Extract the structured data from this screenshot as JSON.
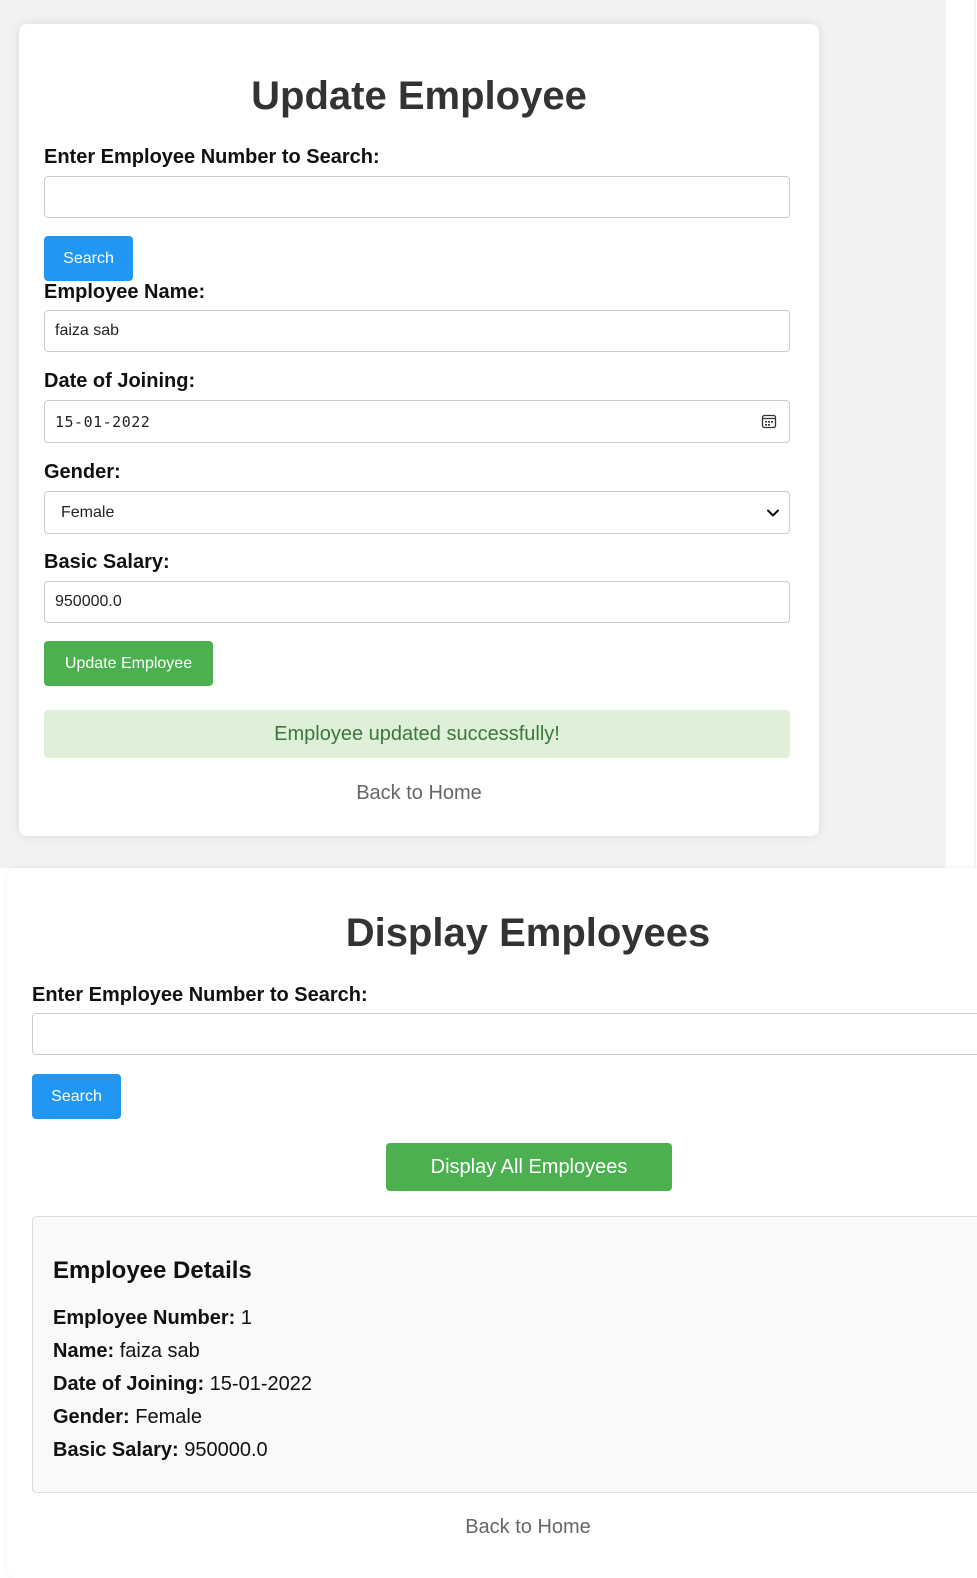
{
  "update_form": {
    "title": "Update Employee",
    "search_label": "Enter Employee Number to Search:",
    "search_value": "",
    "search_button": "Search",
    "name_label": "Employee Name:",
    "name_value": "faiza sab",
    "doj_label": "Date of Joining:",
    "doj_value": "15-01-2022",
    "gender_label": "Gender:",
    "gender_value": "Female",
    "salary_label": "Basic Salary:",
    "salary_value": "950000.0",
    "update_button": "Update Employee",
    "success_message": "Employee updated successfully!",
    "back_link": "Back to Home"
  },
  "display_form": {
    "title": "Display Employees",
    "search_label": "Enter Employee Number to Search:",
    "search_value": "",
    "search_button": "Search",
    "display_all_button": "Display All Employees",
    "details": {
      "heading": "Employee Details",
      "rows": [
        {
          "label": "Employee Number:",
          "value": "1"
        },
        {
          "label": "Name:",
          "value": "faiza sab"
        },
        {
          "label": "Date of Joining:",
          "value": "15-01-2022"
        },
        {
          "label": "Gender:",
          "value": "Female"
        },
        {
          "label": "Basic Salary:",
          "value": "950000.0"
        }
      ]
    },
    "back_link": "Back to Home"
  },
  "colors": {
    "primary_blue": "#2196f3",
    "success_green": "#4caf50",
    "success_bg": "#dff0d8",
    "success_text": "#3c763d"
  },
  "icons": {
    "date_picker": "calendar-icon",
    "gender_dropdown": "chevron-down-icon"
  }
}
